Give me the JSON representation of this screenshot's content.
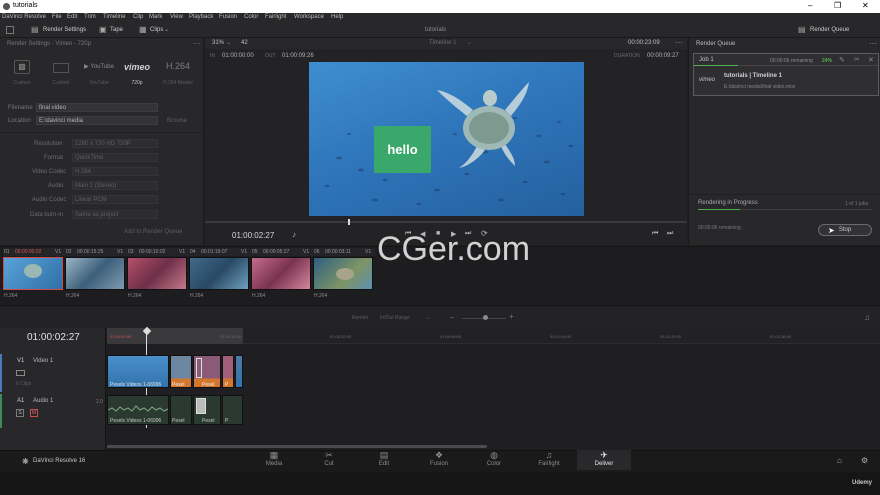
{
  "window": {
    "title": "tutorials"
  },
  "menu": [
    "DaVinci Resolve",
    "File",
    "Edit",
    "Trim",
    "Timeline",
    "Clip",
    "Mark",
    "View",
    "Playback",
    "Fusion",
    "Color",
    "Fairlight",
    "Workspace",
    "Help"
  ],
  "toolbar": {
    "render_settings": "Render Settings",
    "tape": "Tape",
    "clips": "Clips",
    "project": "tutorials",
    "render_queue": "Render Queue"
  },
  "render_settings": {
    "header": "Render Settings - Vimeo - 720p",
    "presets": [
      {
        "label": "Custom",
        "icon": "custom"
      },
      {
        "label": "YouTube",
        "icon": "youtube"
      },
      {
        "label": "720p",
        "icon": "vimeo"
      },
      {
        "label": "H.264 Master",
        "icon": "h264"
      }
    ],
    "preset_main": "Custom",
    "filename_label": "Filename",
    "filename": "final video",
    "location_label": "Location",
    "location": "E:\\davinci media",
    "browse": "Browse",
    "rows": [
      {
        "label": "Resolution",
        "value": "1280 x 720 HD 720P"
      },
      {
        "label": "Format",
        "value": "QuickTime"
      },
      {
        "label": "Video Codec",
        "value": "H.264"
      },
      {
        "label": "Audio",
        "value": "Main 1 (Stereo)"
      },
      {
        "label": "Audio Codec",
        "value": "Linear PCM"
      },
      {
        "label": "Data burn-in",
        "value": "Same as project"
      }
    ],
    "add_to_queue": "Add to Render Queue"
  },
  "viewer": {
    "zoom": "31%",
    "zoom_val": "42",
    "in_label": "IN",
    "in_tc": "01:00:00:00",
    "out_label": "OUT",
    "out_tc": "01:00:09:26",
    "timeline": "Timeline 1",
    "tc_right": "00:00:23:09",
    "duration_label": "DURATION",
    "duration": "00:00:09:27",
    "overlay_text": "hello",
    "current_tc": "01:00:02:27"
  },
  "queue": {
    "header": "Render Queue",
    "job_label": "Job 1",
    "job_remaining": "00:00:06 remaining",
    "job_percent": "24%",
    "job_title": "tutorials | Timeline 1",
    "job_path": "E:\\davinci media\\final video.mov",
    "job_logo": "vimeo",
    "status": "Rendering in Progress",
    "jobs_count": "1 of 1 jobs",
    "remaining": "00:00:06 remaining",
    "stop": "Stop"
  },
  "clips": [
    {
      "num": "01",
      "tc": "00:00:00:02",
      "track": "V1",
      "codec": "H.264"
    },
    {
      "num": "02",
      "tc": "00:00:15:25",
      "track": "V1",
      "codec": "H.264"
    },
    {
      "num": "03",
      "tc": "00:00:10:02",
      "track": "V1",
      "codec": "H.264"
    },
    {
      "num": "04",
      "tc": "00:01:19:07",
      "track": "V1",
      "codec": "H.264"
    },
    {
      "num": "05",
      "tc": "00:00:05:27",
      "track": "V1",
      "codec": "H.264"
    },
    {
      "num": "06",
      "tc": "00:00:03:11",
      "track": "V1",
      "codec": "H.264"
    }
  ],
  "timeline": {
    "tc": "01:00:02:27",
    "render_label": "Render",
    "render_range": "In/Out Range",
    "ruler": [
      "01:00:00:00",
      "01:00:16:00",
      "01:00:32:00",
      "01:00:48:00",
      "01:01:04:00",
      "01:01:20:00",
      "01:01:36:00"
    ],
    "v1_id": "V1",
    "v1_name": "Video 1",
    "v1_info": "6 Clips",
    "a1_id": "A1",
    "a1_name": "Audio 1",
    "a1_val": "2.0",
    "clip_name": "Pexels Videos 1-06996",
    "clip_short": "Pexel",
    "clip_p": "P"
  },
  "nav": [
    {
      "label": "Media",
      "icon": "▦"
    },
    {
      "label": "Cut",
      "icon": "✂"
    },
    {
      "label": "Edit",
      "icon": "▤"
    },
    {
      "label": "Fusion",
      "icon": "❖"
    },
    {
      "label": "Color",
      "icon": "◍"
    },
    {
      "label": "Fairlight",
      "icon": "♫"
    },
    {
      "label": "Deliver",
      "icon": "✈"
    }
  ],
  "app": {
    "name": "DaVinci Resolve 16"
  },
  "watermark": {
    "text": "CGer.com",
    "udemy": "Udemy"
  },
  "colors": {
    "accent": "#4fae4f",
    "panel": "#28282a",
    "bg": "#1f1f21",
    "active_tab": "#e8e8ea"
  }
}
